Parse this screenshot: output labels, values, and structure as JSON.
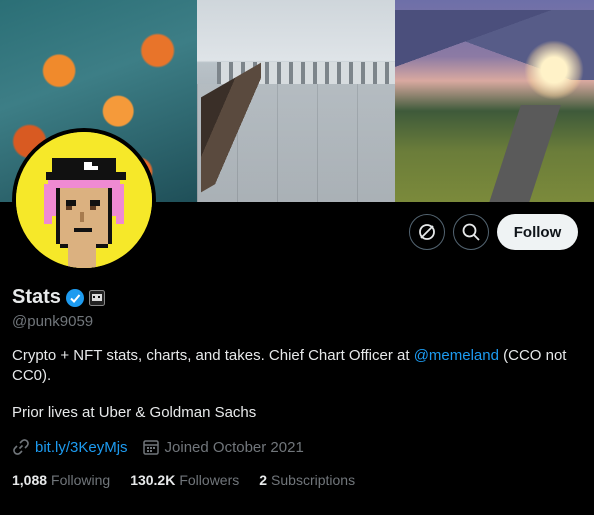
{
  "banner": {
    "panels": [
      "koi fish",
      "pier with benches",
      "mountain road landscape"
    ]
  },
  "profile": {
    "display_name": "Stats",
    "handle": "@punk9059",
    "verified_icon": "verified-badge-icon",
    "affiliate_icon": "affiliation-badge-icon",
    "bio_line1_pre": "Crypto + NFT stats, charts, and takes.  Chief Chart Officer at ",
    "bio_mention": "@memeland",
    "bio_line1_post": " (CCO not CC0).",
    "bio_line2": "Prior lives at Uber & Goldman Sachs",
    "website": "bit.ly/3KeyMjs",
    "joined": "Joined October 2021"
  },
  "actions": {
    "follow_label": "Follow",
    "more_icon": "circle-slash-icon",
    "search_icon": "search-icon"
  },
  "stats": {
    "following_count": "1,088",
    "following_label": "Following",
    "followers_count": "130.2K",
    "followers_label": "Followers",
    "subscriptions_count": "2",
    "subscriptions_label": "Subscriptions"
  },
  "colors": {
    "accent": "#1d9bf0",
    "muted": "#71767b",
    "text": "#e7e9ea",
    "avatar_bg": "#f6e829"
  }
}
